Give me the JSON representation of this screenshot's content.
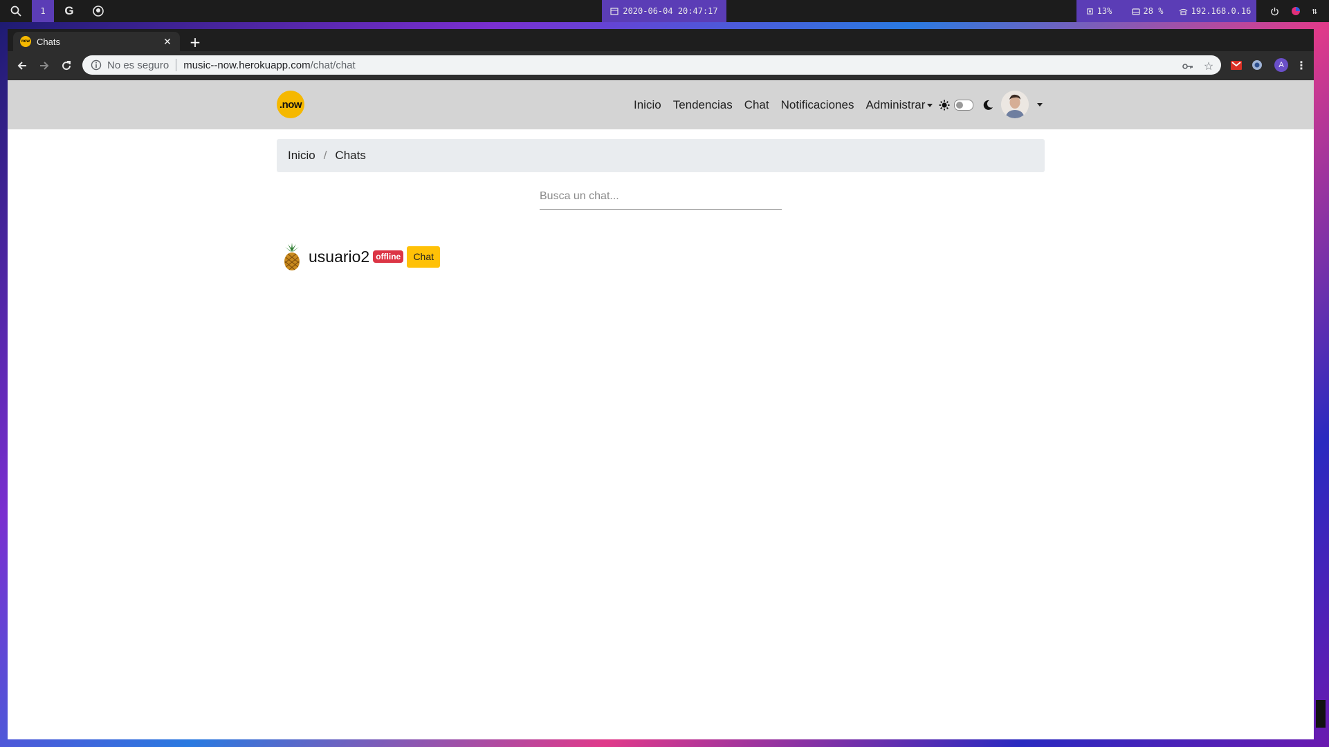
{
  "os": {
    "workspace": "1",
    "datetime": "2020-06-04 20:47:17",
    "cpu": "13%",
    "disk": "28 %",
    "ip": "192.168.0.16"
  },
  "browser": {
    "tab_title": "Chats",
    "security_label": "No es seguro",
    "url_host": "music--now.herokuapp.com",
    "url_path": "/chat/chat",
    "profile_initial": "A"
  },
  "navbar": {
    "logo_text": ".now",
    "links": [
      "Inicio",
      "Tendencias",
      "Chat",
      "Notificaciones",
      "Administrar"
    ]
  },
  "breadcrumb": {
    "items": [
      "Inicio",
      "Chats"
    ],
    "separator": "/"
  },
  "search": {
    "placeholder": "Busca un chat..."
  },
  "chats": [
    {
      "username": "usuario2",
      "status": "offline",
      "button": "Chat"
    }
  ],
  "colors": {
    "brand_yellow": "#f5b800",
    "offline_badge": "#dc3545",
    "chat_button": "#ffc107",
    "navbar_bg": "#d4d4d4",
    "os_accent": "#5b3db6"
  }
}
